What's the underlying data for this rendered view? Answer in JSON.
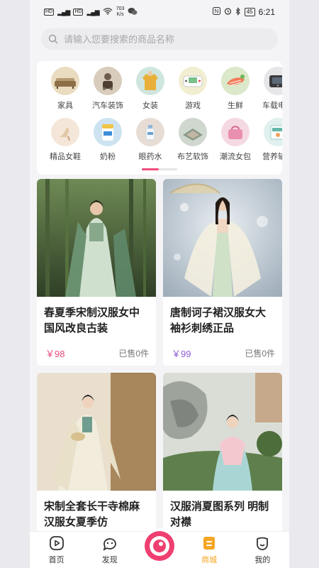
{
  "status": {
    "sim1": "HD",
    "sim2": "HD",
    "net1": "4G",
    "net2": "4G",
    "speed_value": "703",
    "speed_unit": "K/s",
    "battery": "45",
    "time": "6:21"
  },
  "search": {
    "placeholder": "请输入您要搜索的商品名称"
  },
  "categories": {
    "row1": [
      {
        "label": "家具",
        "icon": "sofa-icon",
        "color": "#e9dcc0"
      },
      {
        "label": "汽车装饰",
        "icon": "car-ornament-icon",
        "color": "#d8cdbd"
      },
      {
        "label": "女装",
        "icon": "jacket-icon",
        "color": "#cfe6df"
      },
      {
        "label": "游戏",
        "icon": "gameboy-icon",
        "color": "#f2eed2"
      },
      {
        "label": "生鲜",
        "icon": "salmon-icon",
        "color": "#dbe8c9"
      },
      {
        "label": "车载电器",
        "icon": "car-device-icon",
        "color": "#e6e6e8"
      }
    ],
    "row2": [
      {
        "label": "精品女鞋",
        "icon": "heels-icon",
        "color": "#f4e6d8"
      },
      {
        "label": "奶粉",
        "icon": "milk-powder-icon",
        "color": "#cde3f1"
      },
      {
        "label": "眼药水",
        "icon": "eye-drops-icon",
        "color": "#e7ddd5"
      },
      {
        "label": "布艺软饰",
        "icon": "rug-icon",
        "color": "#cfd7cf"
      },
      {
        "label": "潮流女包",
        "icon": "handbag-icon",
        "color": "#f4d9e3"
      },
      {
        "label": "营养辅食",
        "icon": "baby-food-icon",
        "color": "#dff0ee"
      }
    ]
  },
  "products": [
    {
      "title": "春夏季宋制汉服女中国风改良古装",
      "price": "￥98",
      "sold": "已售0件",
      "price_color": "#e8497a",
      "image": "bamboo-hanfu-photo"
    },
    {
      "title": "唐制诃子裙汉服女大袖衫刺绣正品",
      "price": "￥99",
      "sold": "已售0件",
      "price_color": "#8e5ad6",
      "image": "umbrella-hanfu-photo"
    },
    {
      "title": "宋制全套长干寺棉麻汉服女夏季仿",
      "price": "",
      "sold": "",
      "price_color": "#e8497a",
      "image": "cream-hanfu-photo"
    },
    {
      "title": "汉服消夏图系列 明制对襟",
      "price": "",
      "sold": "",
      "price_color": "#e8497a",
      "image": "rock-garden-hanfu-photo"
    }
  ],
  "tabbar": {
    "home": "首页",
    "discover": "发现",
    "mall": "商城",
    "mine": "我的",
    "active_color": "#f5a623",
    "center_color": "#ef3f70"
  }
}
